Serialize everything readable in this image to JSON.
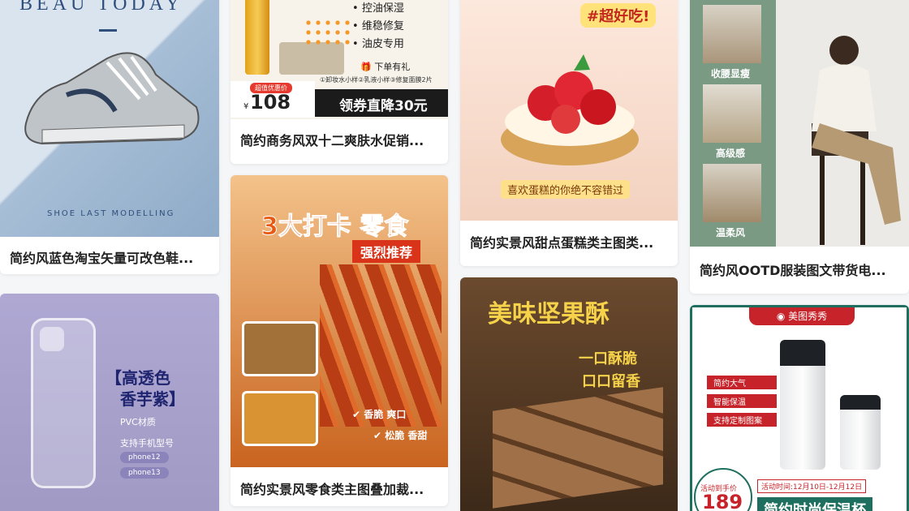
{
  "cards": [
    {
      "title": "简约风蓝色淘宝矢量可改色鞋...",
      "brand": "BEAU TODAY",
      "caption": "SHOE LAST MODELLING",
      "colors": {
        "bg": "#a9bfd6",
        "bg2": "#d7e3ef"
      }
    },
    {
      "title": "简约商务风双十二爽肤水促销...",
      "bullets": [
        "控油保湿",
        "维稳修复",
        "油皮专用"
      ],
      "gift": "下单有礼",
      "gift_note": "①卸妆水小样②乳液小样③修复面膜2片",
      "price_tag": "超值优惠价",
      "price_symbol": "¥",
      "price": "108",
      "coupon": "领券直降30元"
    },
    {
      "title": "简约实景风甜点蛋糕类主图类...",
      "tag": "#超好吃!",
      "slogan": "喜欢蛋糕的你绝不容错过"
    },
    {
      "title": "简约风OOTD服装图文带货电...",
      "labels": [
        "收腰显瘦",
        "高级感",
        "温柔风"
      ],
      "colors": {
        "side": "#7a9a83"
      }
    },
    {
      "title": "",
      "heading_line1": "【高透色",
      "heading_line2": "香芋紫】",
      "material": "PVC材质",
      "support": "支持手机型号",
      "models": [
        "phone12",
        "phone13"
      ],
      "colors": {
        "bg": "#a9a4cc"
      }
    },
    {
      "title": "简约实景风零食类主图叠加裁...",
      "headline_a": "3大打卡",
      "headline_b": "零食",
      "sub": "强烈推荐",
      "tags": [
        "香脆 爽口",
        "松脆 香甜"
      ]
    },
    {
      "title": "",
      "headline": "美味坚果酥",
      "sub_line1": "一口酥脆",
      "sub_line2": "口口留香"
    },
    {
      "title": "",
      "brand": "美图秀秀",
      "features": [
        "简约大气",
        "智能保温",
        "支持定制图案"
      ],
      "promo_label": "活动到手价",
      "promo_price": "189",
      "promo_time": "活动时间:12月10日-12月12日",
      "product_name": "简约时尚保温杯"
    }
  ]
}
